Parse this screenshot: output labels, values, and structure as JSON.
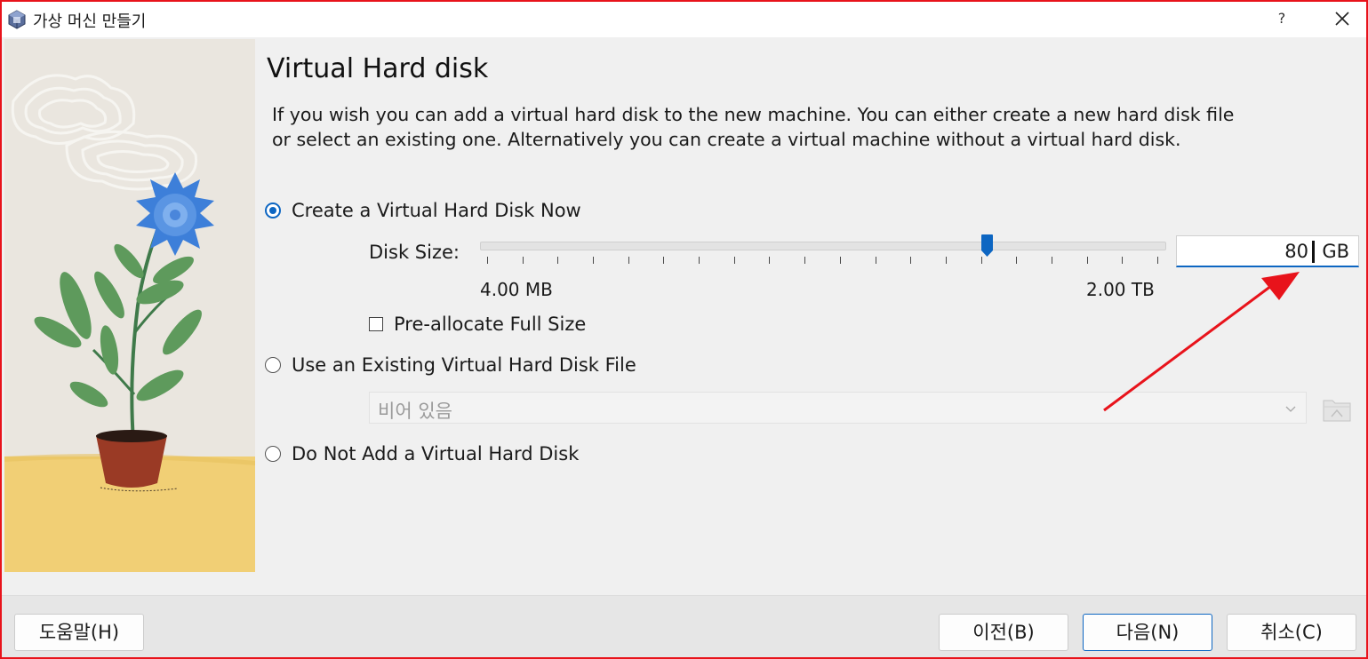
{
  "window": {
    "title": "가상 머신 만들기",
    "help_label": "?"
  },
  "page": {
    "title": "Virtual Hard disk",
    "description": "If you wish you can add a virtual hard disk to the new machine. You can either create a new hard disk file or select an existing one. Alternatively you can create a virtual machine without a virtual hard disk."
  },
  "options": {
    "create_now": {
      "label": "Create a Virtual Hard Disk Now",
      "selected": true
    },
    "use_existing": {
      "label": "Use an Existing Virtual Hard Disk File",
      "selected": false
    },
    "do_not_add": {
      "label": "Do Not Add a Virtual Hard Disk",
      "selected": false
    }
  },
  "disk_size": {
    "label": "Disk Size:",
    "min_label": "4.00 MB",
    "max_label": "2.00 TB",
    "slider_position": 0.74,
    "value": "80",
    "unit": "GB"
  },
  "preallocate": {
    "label": "Pre-allocate Full Size",
    "checked": false
  },
  "existing_file": {
    "selected": "비어 있음"
  },
  "buttons": {
    "help": "도움말(H)",
    "back": "이전(B)",
    "next": "다음(N)",
    "cancel": "취소(C)"
  },
  "colors": {
    "accent": "#0d66c2",
    "annotation": "#e8131b",
    "frame": "#e8131b"
  },
  "icons": {
    "app": "virtualbox-icon",
    "close": "close-icon",
    "dropdown": "chevron-down-icon",
    "folder": "folder-icon"
  }
}
